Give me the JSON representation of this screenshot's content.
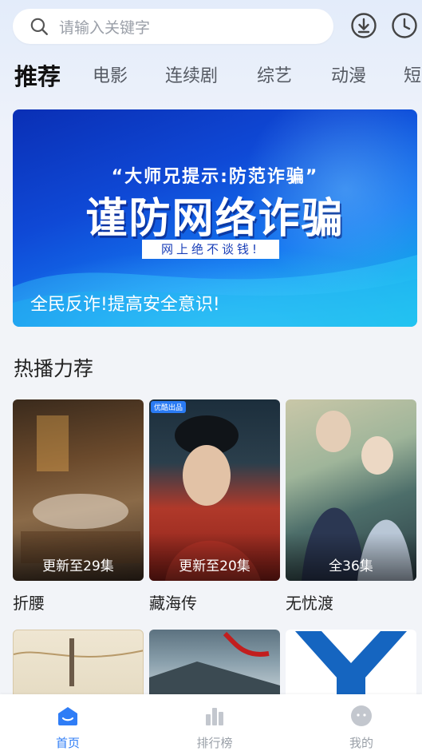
{
  "search": {
    "placeholder": "请输入关键字"
  },
  "header_icons": [
    "download-icon",
    "history-clock-icon"
  ],
  "tabs": [
    {
      "label": "推荐",
      "active": true
    },
    {
      "label": "电影",
      "active": false
    },
    {
      "label": "连续剧",
      "active": false
    },
    {
      "label": "综艺",
      "active": false
    },
    {
      "label": "动漫",
      "active": false
    },
    {
      "label": "短",
      "active": false
    }
  ],
  "banner": {
    "subtitle": "“大师兄提示:防范诈骗”",
    "headline": "谨防网络诈骗",
    "boxed_text": "网上绝不谈钱!",
    "caption": "全民反诈!提高安全意识!"
  },
  "section": {
    "title": "热播力荐",
    "cards": [
      {
        "title": "折腰",
        "episode": "更新至29集",
        "tag": ""
      },
      {
        "title": "藏海传",
        "episode": "更新至20集",
        "tag": "优酷出品"
      },
      {
        "title": "无忧渡",
        "episode": "全36集",
        "tag": ""
      }
    ]
  },
  "bottom_nav": [
    {
      "label": "首页",
      "icon": "home-icon",
      "active": true
    },
    {
      "label": "排行榜",
      "icon": "ranking-icon",
      "active": false
    },
    {
      "label": "我的",
      "icon": "profile-icon",
      "active": false
    }
  ],
  "colors": {
    "accent": "#2f7df6",
    "banner_blue": "#0f49d6"
  }
}
